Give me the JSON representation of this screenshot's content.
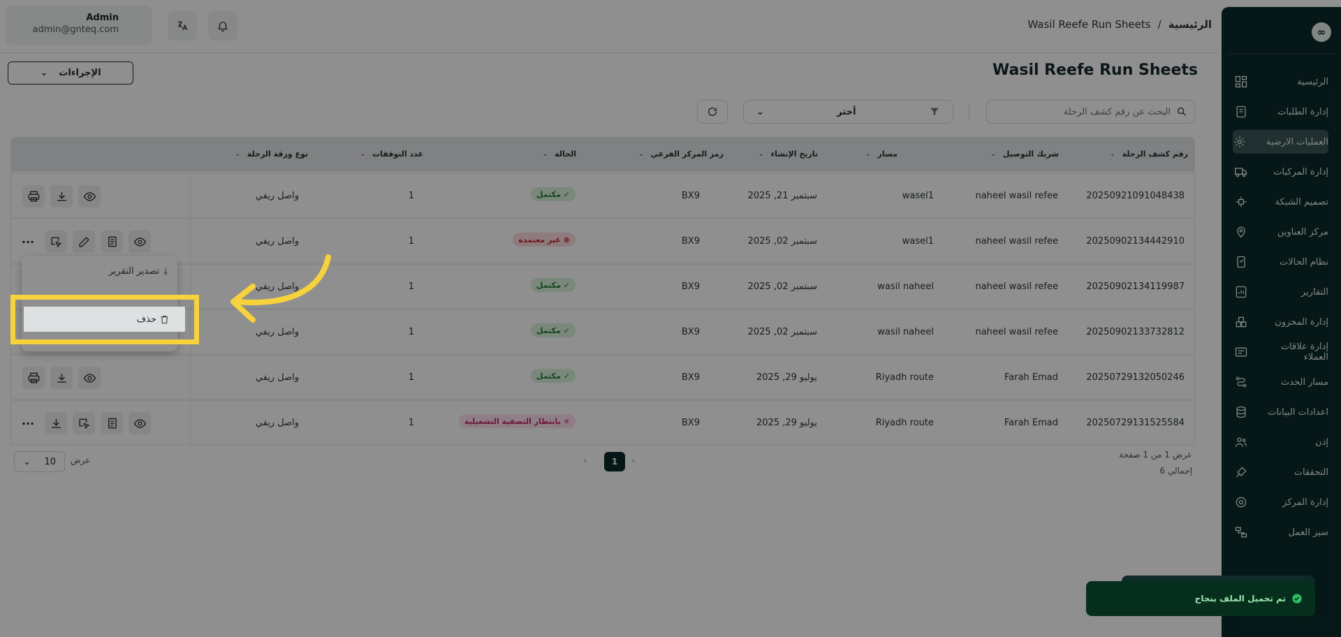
{
  "user": {
    "name": "Admin",
    "email": "admin@gnteq.com"
  },
  "breadcrumb": {
    "home": "الرئيسية",
    "separator": "/",
    "current": "Wasil Reefe Run Sheets"
  },
  "page": {
    "title": "Wasil Reefe Run Sheets",
    "actions_label": "الإجراءات"
  },
  "filters": {
    "search_placeholder": "البحث عن رقم كشف الرحلة",
    "select_value": "أختر"
  },
  "sidebar": {
    "items": [
      {
        "label": "الرئيسية",
        "icon": "home-icon"
      },
      {
        "label": "إدارة الطلبات",
        "icon": "orders-icon"
      },
      {
        "label": "العمليات الارضية",
        "icon": "ground-ops-icon",
        "active": true
      },
      {
        "label": "إدارة المركبات",
        "icon": "truck-icon"
      },
      {
        "label": "تصميم الشبكة",
        "icon": "network-icon"
      },
      {
        "label": "مركز العناوين",
        "icon": "location-icon"
      },
      {
        "label": "نظام الحالات",
        "icon": "status-icon"
      },
      {
        "label": "التقارير",
        "icon": "reports-icon"
      },
      {
        "label": "إدارة المخزون",
        "icon": "inventory-icon"
      },
      {
        "label": "إدارة علاقات العملاء",
        "icon": "crm-icon"
      },
      {
        "label": "مسار الحدث",
        "icon": "route-icon"
      },
      {
        "label": "اعدادات البيانات",
        "icon": "database-icon"
      },
      {
        "label": "إذن",
        "icon": "users-icon"
      },
      {
        "label": "التحققات",
        "icon": "verify-icon"
      },
      {
        "label": "إدارة المركز",
        "icon": "gear-icon"
      },
      {
        "label": "سير العمل",
        "icon": "workflow-icon"
      }
    ]
  },
  "table": {
    "headers": [
      "رقم كشف الرحلة",
      "شريك التوصيل",
      "مسار",
      "تاريخ الإنشاء",
      "رمز المركز الفرعي",
      "الحالة",
      "عدد التوقفات",
      "نوع ورقة الرحلة"
    ],
    "rows": [
      {
        "id": "20250921091048438",
        "partner": "naheel wasil refee",
        "route": "wasel1",
        "date": "سبتمبر 21, 2025",
        "code": "BX9",
        "status": "مكتمل",
        "stops": "1",
        "type": "واصل ريفي"
      },
      {
        "id": "20250902134442910",
        "partner": "naheel wasil refee",
        "route": "wasel1",
        "date": "سبتمبر 02, 2025",
        "code": "BX9",
        "status": "غير معتمدة",
        "stops": "1",
        "type": "واصل ريفي"
      },
      {
        "id": "20250902134119987",
        "partner": "naheel wasil refee",
        "route": "wasil naheel",
        "date": "سبتمبر 02, 2025",
        "code": "BX9",
        "status": "مكتمل",
        "stops": "1",
        "type": "واصل ريفي"
      },
      {
        "id": "20250902133732812",
        "partner": "naheel wasil refee",
        "route": "wasil naheel",
        "date": "سبتمبر 02, 2025",
        "code": "BX9",
        "status": "مكتمل",
        "stops": "1",
        "type": "واصل ريفي"
      },
      {
        "id": "20250729132050246",
        "partner": "Farah Emad",
        "route": "Riyadh route",
        "date": "يوليو 29, 2025",
        "code": "BX9",
        "status": "مكتمل",
        "stops": "1",
        "type": "واصل ريفي"
      },
      {
        "id": "20250729131525584",
        "partner": "Farah Emad",
        "route": "Riyadh route",
        "date": "يوليو 29, 2025",
        "code": "BX9",
        "status": "بانتظار التصفية التشغيلية",
        "stops": "1",
        "type": "واصل ريفي"
      }
    ]
  },
  "menu": {
    "export_label": "تصدير التقرير",
    "delete_label": "حذف"
  },
  "pagination": {
    "info": "عرض 1 من 1 صفحة",
    "total": "إجمالي 6",
    "page": "1",
    "page_size": "10",
    "show_label": "عرض"
  },
  "toast": {
    "message": "تم تحميل الملف بنجاح"
  },
  "colors": {
    "sidebar": "#0c2a2b",
    "highlight": "#f7d23c",
    "toast": "#052f1c"
  }
}
